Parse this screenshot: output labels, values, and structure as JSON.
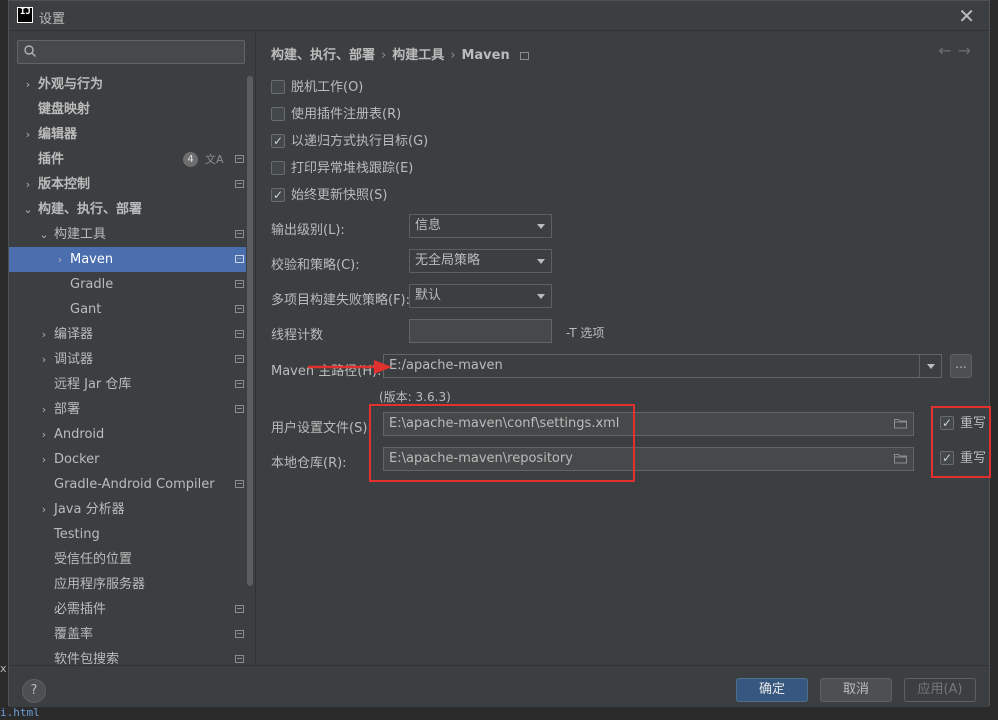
{
  "window": {
    "title": "设置",
    "logo_text_top": "IJ",
    "close_glyph": "✕"
  },
  "background": {
    "left_char": "x",
    "bottom_text": "i.html"
  },
  "sidebar": {
    "search_placeholder": "Q-",
    "items": [
      {
        "label": "外观与行为",
        "indent": 0,
        "chevron": "›",
        "bold": true
      },
      {
        "label": "键盘映射",
        "indent": 0,
        "chevron": "",
        "bold": true
      },
      {
        "label": "编辑器",
        "indent": 0,
        "chevron": "›",
        "bold": true
      },
      {
        "label": "插件",
        "indent": 0,
        "chevron": "",
        "bold": true,
        "badge": "4"
      },
      {
        "label": "版本控制",
        "indent": 0,
        "chevron": "›",
        "bold": true
      },
      {
        "label": "构建、执行、部署",
        "indent": 0,
        "chevron": "⌄",
        "bold": true
      },
      {
        "label": "构建工具",
        "indent": 1,
        "chevron": "⌄"
      },
      {
        "label": "Maven",
        "indent": 2,
        "chevron": "›",
        "selected": true
      },
      {
        "label": "Gradle",
        "indent": 2,
        "chevron": ""
      },
      {
        "label": "Gant",
        "indent": 2,
        "chevron": ""
      },
      {
        "label": "编译器",
        "indent": 1,
        "chevron": "›"
      },
      {
        "label": "调试器",
        "indent": 1,
        "chevron": "›"
      },
      {
        "label": "远程 Jar 仓库",
        "indent": 1,
        "chevron": ""
      },
      {
        "label": "部署",
        "indent": 1,
        "chevron": "›"
      },
      {
        "label": "Android",
        "indent": 1,
        "chevron": "›"
      },
      {
        "label": "Docker",
        "indent": 1,
        "chevron": "›"
      },
      {
        "label": "Gradle-Android Compiler",
        "indent": 1,
        "chevron": ""
      },
      {
        "label": "Java 分析器",
        "indent": 1,
        "chevron": "›"
      },
      {
        "label": "Testing",
        "indent": 1,
        "chevron": ""
      },
      {
        "label": "受信任的位置",
        "indent": 1,
        "chevron": ""
      },
      {
        "label": "应用程序服务器",
        "indent": 1,
        "chevron": ""
      },
      {
        "label": "必需插件",
        "indent": 1,
        "chevron": ""
      },
      {
        "label": "覆盖率",
        "indent": 1,
        "chevron": ""
      },
      {
        "label": "软件包搜索",
        "indent": 1,
        "chevron": ""
      }
    ]
  },
  "breadcrumb": {
    "part1": "构建、执行、部署",
    "part2": "构建工具",
    "part3": "Maven",
    "sep": "›"
  },
  "nav": {
    "back": "←",
    "forward": "→"
  },
  "checkboxes": [
    {
      "label": "脱机工作(O)",
      "checked": false
    },
    {
      "label": "使用插件注册表(R)",
      "checked": false
    },
    {
      "label": "以递归方式执行目标(G)",
      "checked": true
    },
    {
      "label": "打印异常堆栈跟踪(E)",
      "checked": false
    },
    {
      "label": "始终更新快照(S)",
      "checked": true
    }
  ],
  "fields": {
    "output_level_label": "输出级别(L):",
    "output_level_value": "信息",
    "checksum_label": "校验和策略(C):",
    "checksum_value": "无全局策略",
    "multiproject_label": "多项目构建失败策略(F):",
    "multiproject_value": "默认",
    "threads_label": "线程计数",
    "threads_value": "",
    "threads_hint": "-T 选项",
    "maven_home_label": "Maven 主路径(H):",
    "maven_home_value": "E:/apache-maven",
    "maven_version": "(版本: 3.6.3)",
    "browse_label": "...",
    "user_settings_label": "用户设置文件(S):",
    "user_settings_value": "E:\\apache-maven\\conf\\settings.xml",
    "local_repo_label": "本地仓库(R):",
    "local_repo_value": "E:\\apache-maven\\repository",
    "override_label_1": "重写",
    "override_label_2": "重写"
  },
  "footer": {
    "help": "?",
    "ok": "确定",
    "cancel": "取消",
    "apply": "应用(A)"
  },
  "colors": {
    "accent": "#4b6eaf",
    "annotation_red": "#e0312f",
    "panel": "#3c3f41"
  }
}
